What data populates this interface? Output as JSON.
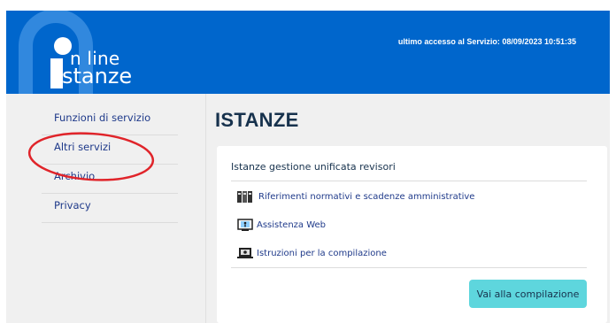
{
  "header": {
    "logo_line1": "n line",
    "logo_line2": "stanze",
    "last_access": "ultimo accesso al Servizio: 08/09/2023 10:51:35"
  },
  "sidebar": {
    "items": [
      {
        "label": "Funzioni di servizio"
      },
      {
        "label": "Altri servizi"
      },
      {
        "label": "Archivio"
      },
      {
        "label": "Privacy"
      }
    ]
  },
  "main": {
    "title": "ISTANZE",
    "card": {
      "title": "Istanze gestione unificata revisori",
      "links": [
        {
          "label": "Riferimenti normativi e scadenze amministrative",
          "icon": "binders-icon"
        },
        {
          "label": "Assistenza Web",
          "icon": "assistance-monitor-icon"
        },
        {
          "label": "Istruzioni per la compilazione",
          "icon": "laptop-icon"
        }
      ],
      "button_label": "Vai alla compilazione"
    }
  },
  "colors": {
    "header_bg": "#0066cc",
    "main_bg": "#f0f0f0",
    "link": "#1f3a8a",
    "button_bg": "#5ed6dd",
    "annotation": "#e0242a"
  }
}
